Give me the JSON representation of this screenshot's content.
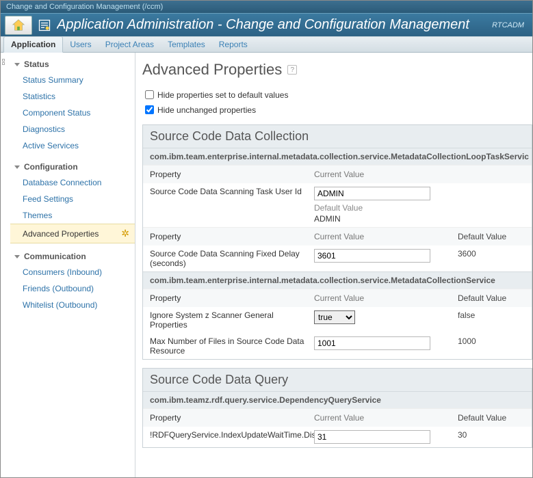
{
  "topbar": {
    "breadcrumb": "Change and Configuration Management (/ccm)"
  },
  "titlebar": {
    "title": "Application Administration - Change and Configuration Management",
    "user": "RTCADM"
  },
  "menubar": {
    "items": [
      {
        "label": "Application",
        "active": true
      },
      {
        "label": "Users"
      },
      {
        "label": "Project Areas"
      },
      {
        "label": "Templates"
      },
      {
        "label": "Reports"
      }
    ]
  },
  "sidebar": {
    "sections": [
      {
        "title": "Status",
        "items": [
          {
            "label": "Status Summary"
          },
          {
            "label": "Statistics"
          },
          {
            "label": "Component Status"
          },
          {
            "label": "Diagnostics"
          },
          {
            "label": "Active Services"
          }
        ]
      },
      {
        "title": "Configuration",
        "items": [
          {
            "label": "Database Connection"
          },
          {
            "label": "Feed Settings"
          },
          {
            "label": "Themes"
          },
          {
            "label": "Advanced Properties",
            "active": true
          }
        ]
      },
      {
        "title": "Communication",
        "items": [
          {
            "label": "Consumers (Inbound)"
          },
          {
            "label": "Friends (Outbound)"
          },
          {
            "label": "Whitelist (Outbound)"
          }
        ]
      }
    ]
  },
  "page": {
    "title": "Advanced Properties",
    "hide_default_label": "Hide properties set to default values",
    "hide_default_checked": false,
    "hide_unchanged_label": "Hide unchanged properties",
    "hide_unchanged_checked": true
  },
  "columns": {
    "property": "Property",
    "current": "Current Value",
    "default": "Default Value"
  },
  "groups": [
    {
      "title": "Source Code Data Collection",
      "services": [
        {
          "name": "com.ibm.team.enterprise.internal.metadata.collection.service.MetadataCollectionLoopTaskServic",
          "rows": [
            {
              "property": "Source Code Data Scanning Task User Id",
              "current": "ADMIN",
              "default": "ADMIN",
              "layout": "stacked",
              "input": "text"
            }
          ]
        },
        {
          "inline_header": true,
          "rows": [
            {
              "property": "Source Code Data Scanning Fixed Delay (seconds)",
              "current": "3601",
              "default": "3600",
              "input": "text"
            }
          ]
        },
        {
          "name": "com.ibm.team.enterprise.internal.metadata.collection.service.MetadataCollectionService",
          "rows": [
            {
              "property": "Ignore System z Scanner General Properties",
              "current": "true",
              "default": "false",
              "input": "select"
            },
            {
              "property": "Max Number of Files in Source Code Data Resource",
              "current": "1001",
              "default": "1000",
              "input": "text"
            }
          ]
        }
      ]
    },
    {
      "title": "Source Code Data Query",
      "services": [
        {
          "name": "com.ibm.teamz.rdf.query.service.DependencyQueryService",
          "rows": [
            {
              "property": "!RDFQueryService.IndexUpdateWaitTime.DisplayName!",
              "current": "31",
              "default": "30",
              "input": "text"
            }
          ]
        }
      ]
    }
  ]
}
